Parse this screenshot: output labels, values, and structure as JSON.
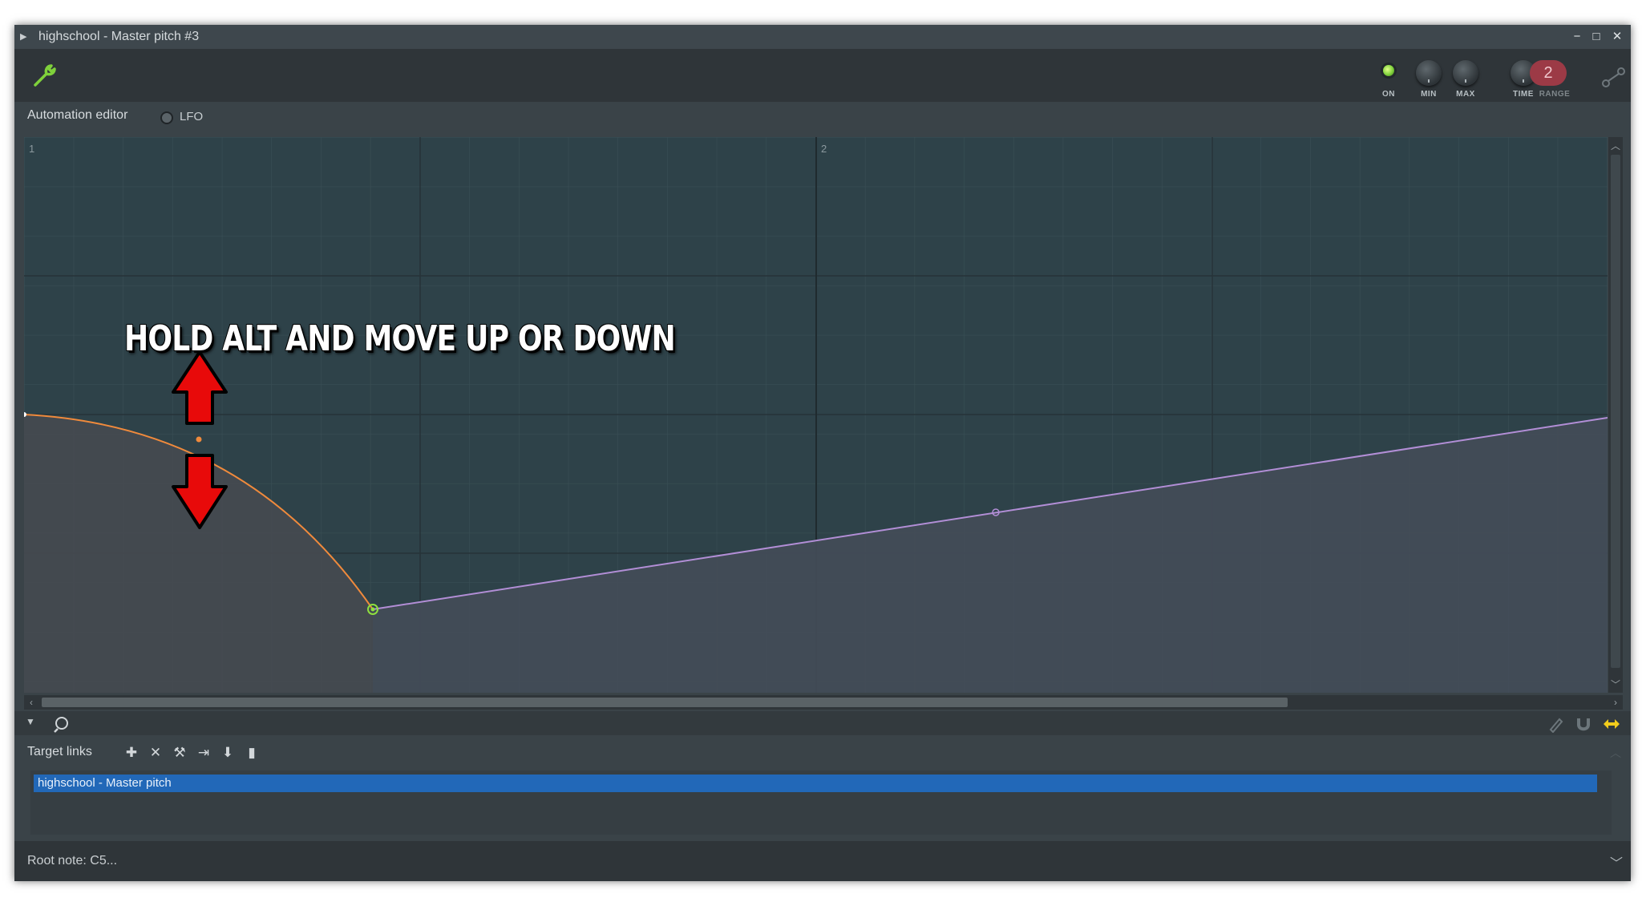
{
  "window": {
    "title": "highschool - Master pitch #3",
    "controls": [
      "minimize",
      "maximize",
      "close"
    ]
  },
  "toolbar": {
    "on_label": "ON",
    "min_label": "MIN",
    "max_label": "MAX",
    "time_label": "TIME",
    "range_label": "RANGE",
    "range_value": "2",
    "on_led_color": "#7fd13b",
    "range_color": "#9c3a46",
    "wrench_icon": "wrench-icon",
    "link_icon": "link-icon"
  },
  "tabs": {
    "automation_editor": "Automation editor",
    "lfo": "LFO"
  },
  "editor": {
    "bar_labels": [
      "1",
      "2"
    ],
    "annotation": "HOLD ALT AND MOVE UP OR DOWN",
    "curve_colors": {
      "curve1": "#f08a3c",
      "curve2": "#b28ed6",
      "selected_point": "#8fe03f",
      "arrows": "#e80a0a"
    },
    "arrow_directions": [
      "up",
      "down"
    ]
  },
  "bottom_toolbar": {
    "icons": [
      "chevron-down-icon",
      "zoom-icon",
      "pencil-icon",
      "magnet-icon",
      "swap-arrows-icon"
    ]
  },
  "target_links": {
    "label": "Target links",
    "icons": [
      "add-icon",
      "remove-icon",
      "wrench-icon",
      "link-arrow-icon",
      "stamp-icon",
      "bars-icon"
    ],
    "items": [
      "highschool - Master pitch"
    ]
  },
  "footer": {
    "root_note": "Root note: C5..."
  }
}
